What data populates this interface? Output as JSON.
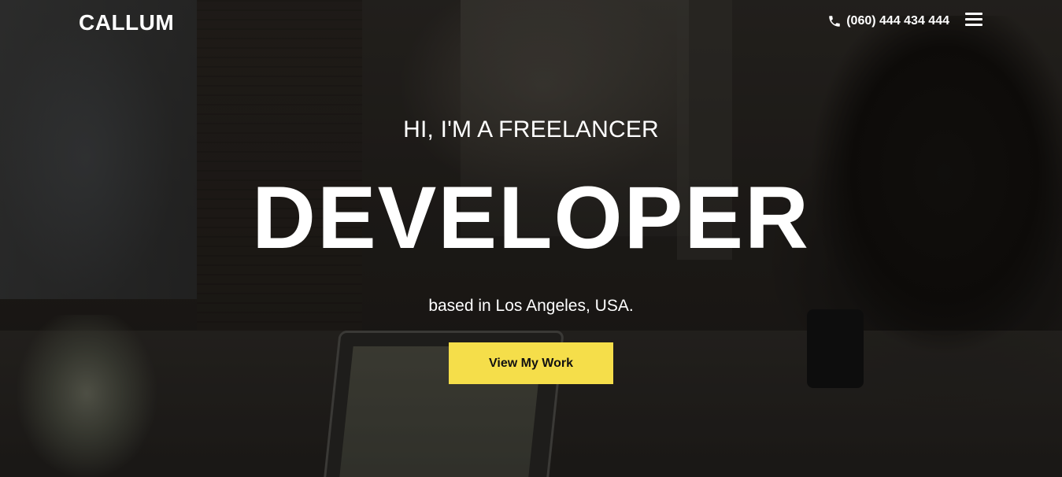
{
  "header": {
    "logo_text": "CALLUM",
    "phone_number": "(060) 444 434 444",
    "phone_icon": "phone-icon",
    "menu_icon": "hamburger-menu-icon"
  },
  "hero": {
    "intro": "HI, I'M A FREELANCER",
    "headline": "DEVELOPER",
    "location": "based in Los Angeles, USA.",
    "cta_label": "View My Work"
  },
  "colors": {
    "accent": "#f5de4a",
    "text": "#ffffff",
    "button_text": "#111111"
  }
}
